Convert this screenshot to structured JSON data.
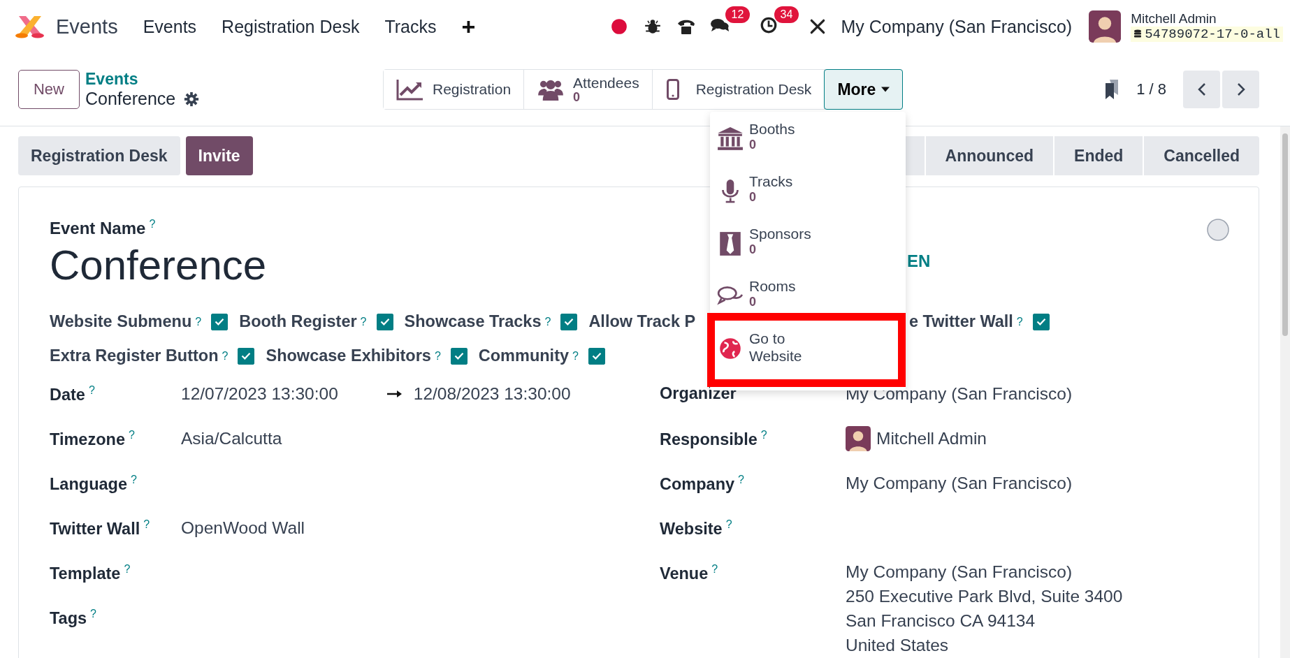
{
  "top_bar": {
    "app_name": "Events",
    "menu": [
      "Events",
      "Registration Desk",
      "Tracks"
    ],
    "add": "+",
    "chat_badge": "12",
    "activity_badge": "34",
    "company": "My Company (San Francisco)",
    "user": "Mitchell Admin",
    "database": "54789072-17-0-all"
  },
  "control_panel": {
    "new_button": "New",
    "breadcrumb": "Events",
    "record": "Conference",
    "smart_buttons": [
      {
        "kind": "chart",
        "label": "Registration"
      },
      {
        "kind": "users",
        "label": "Attendees",
        "count": "0"
      },
      {
        "kind": "phone",
        "label": "Registration Desk"
      }
    ],
    "more": "More",
    "pager": "1 / 8"
  },
  "more_menu": [
    {
      "kind": "bank",
      "label": "Booths",
      "count": "0",
      "highlighted": false
    },
    {
      "kind": "mic",
      "label": "Tracks",
      "count": "0",
      "highlighted": false
    },
    {
      "kind": "tie",
      "label": "Sponsors",
      "count": "0",
      "highlighted": false
    },
    {
      "kind": "chat",
      "label": "Rooms",
      "count": "0",
      "highlighted": false
    },
    {
      "kind": "globe",
      "label": "Go to Website",
      "highlighted": true
    }
  ],
  "status_bar": {
    "buttons": [
      {
        "label": "Registration Desk",
        "primary": false
      },
      {
        "label": "Invite",
        "primary": true
      }
    ],
    "stages": [
      "Announced",
      "Ended",
      "Cancelled"
    ]
  },
  "form": {
    "name_label": "Event Name",
    "help": "?",
    "title": "Conference",
    "stage_text": "EN",
    "toggles": [
      [
        {
          "label": "Website Submenu",
          "help": "?",
          "checked": true
        },
        {
          "label": "Booth Register",
          "help": "?",
          "checked": true
        },
        {
          "label": "Showcase Tracks",
          "help": "?",
          "checked": true
        },
        {
          "label": "Allow Track P"
        }
      ],
      [
        {
          "label": "Extra Register Button",
          "help": "?",
          "checked": true
        },
        {
          "label": "Showcase Exhibitors",
          "help": "?",
          "checked": true
        },
        {
          "label": "Community",
          "help": "?",
          "checked": true
        }
      ]
    ],
    "toggles_right": {
      "label": "e Twitter Wall",
      "help": "?",
      "checked": true
    },
    "left_fields": [
      {
        "label": "Date",
        "help": "?",
        "kind": "range",
        "value": "12/07/2023 13:30:00",
        "value_end": "12/08/2023 13:30:00"
      },
      {
        "label": "Timezone",
        "help": "?",
        "kind": "text",
        "value": "Asia/Calcutta"
      },
      {
        "label": "Language",
        "help": "?",
        "kind": "text"
      },
      {
        "label": "Twitter Wall",
        "help": "?",
        "kind": "text",
        "value": "OpenWood Wall"
      },
      {
        "label": "Template",
        "help": "?",
        "kind": "text"
      },
      {
        "label": "Tags",
        "help": "?",
        "kind": "text"
      }
    ],
    "right_fields": [
      {
        "label": "Organizer",
        "kind": "text",
        "value": "My Company (San Francisco)"
      },
      {
        "label": "Responsible",
        "help": "?",
        "kind": "user",
        "value": "Mitchell Admin"
      },
      {
        "label": "Company",
        "help": "?",
        "kind": "text",
        "value": "My Company (San Francisco)"
      },
      {
        "label": "Website",
        "help": "?",
        "kind": "text"
      },
      {
        "label": "Venue",
        "help": "?",
        "kind": "address",
        "lines": [
          "My Company (San Francisco)",
          "250 Executive Park Blvd, Suite 3400",
          "San Francisco CA 94134",
          "United States"
        ]
      }
    ]
  }
}
